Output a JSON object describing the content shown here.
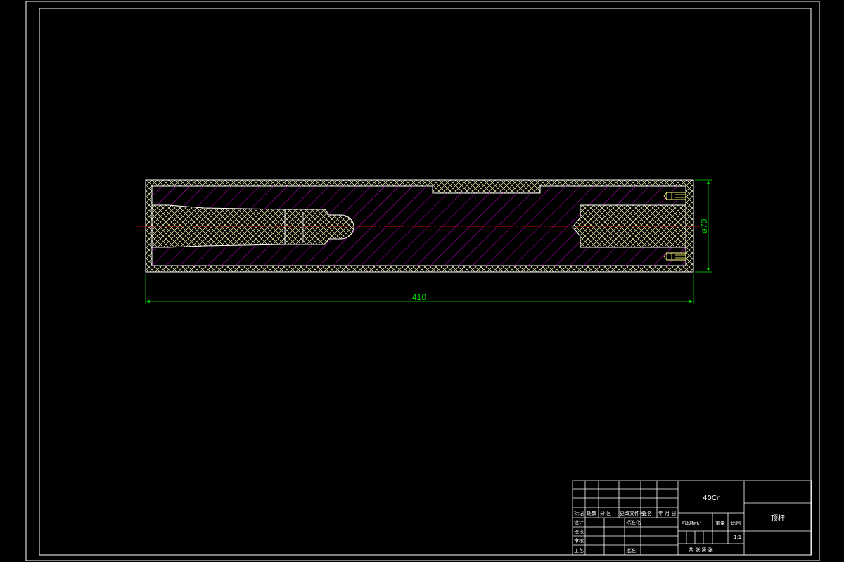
{
  "drawing": {
    "dimensions": {
      "length": "410",
      "diameter": "ø70"
    },
    "colors": {
      "background": "#000000",
      "frame": "#ffffff",
      "outline": "#ffffff",
      "hatch_section": "#b000b0",
      "hatch_core": "#ffffc0",
      "center_line": "#c00000",
      "dimension": "#00d800"
    }
  },
  "title_block": {
    "material": "40Cr",
    "part_name": "顶杆",
    "scale": "1:1",
    "header_row": [
      "标记",
      "处数",
      "分 区",
      "更改文件号",
      "签名",
      "年 月 日"
    ],
    "roles": [
      "设计",
      "校核",
      "审核",
      "工艺"
    ],
    "standardization": "标准化",
    "approval": "批准",
    "stage_mark": "阶段标记",
    "weight": "重量",
    "ratio": "比例",
    "sheet_info": "共   张   第   张"
  }
}
